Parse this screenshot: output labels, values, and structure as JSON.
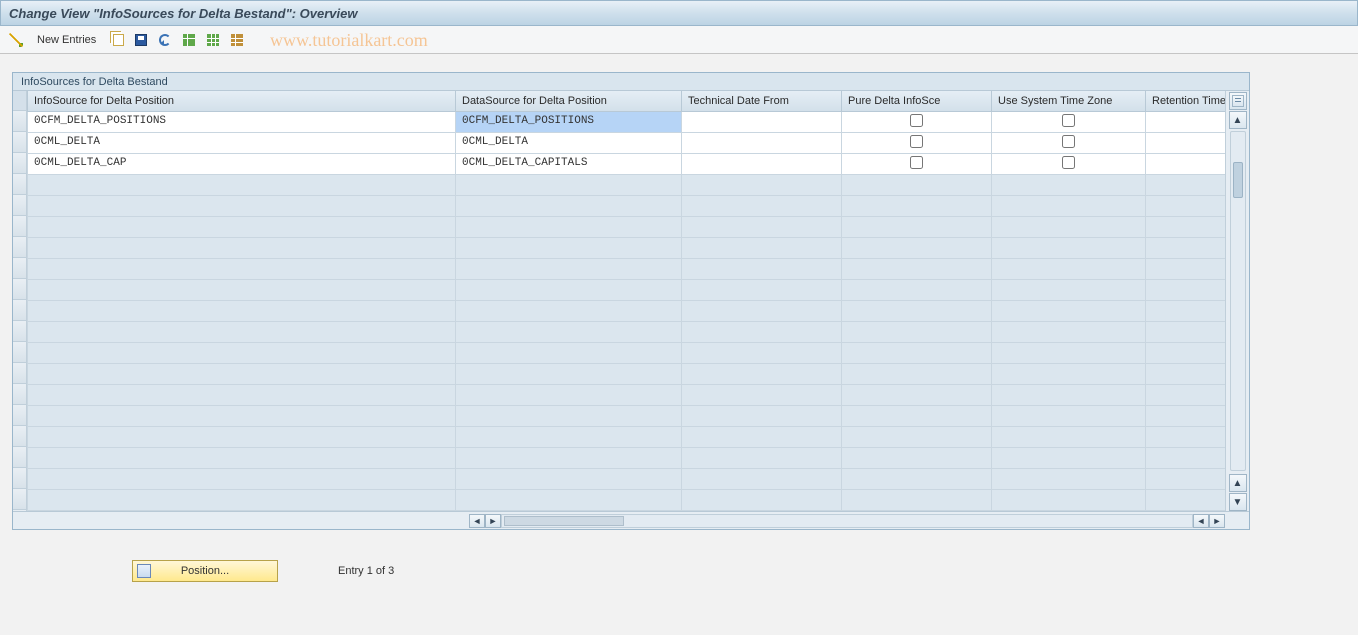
{
  "title": "Change View \"InfoSources for Delta Bestand\": Overview",
  "toolbar": {
    "new_entries_label": "New Entries"
  },
  "watermark": "www.tutorialkart.com",
  "grid": {
    "title": "InfoSources for Delta Bestand",
    "columns": [
      "InfoSource for Delta Position",
      "DataSource for Delta Position",
      "Technical Date From",
      "Pure Delta InfoSce",
      "Use System Time Zone",
      "Retention Time"
    ],
    "rows": [
      {
        "c0": "0CFM_DELTA_POSITIONS",
        "c1": "0CFM_DELTA_POSITIONS",
        "c2": "",
        "c3": false,
        "c4": false,
        "c5": "",
        "selected_cell": 1
      },
      {
        "c0": "0CML_DELTA",
        "c1": "0CML_DELTA",
        "c2": "",
        "c3": false,
        "c4": false,
        "c5": ""
      },
      {
        "c0": "0CML_DELTA_CAP",
        "c1": "0CML_DELTA_CAPITALS",
        "c2": "",
        "c3": false,
        "c4": false,
        "c5": ""
      }
    ],
    "empty_rows": 16
  },
  "footer": {
    "position_label": "Position...",
    "entry_label": "Entry 1 of 3"
  }
}
